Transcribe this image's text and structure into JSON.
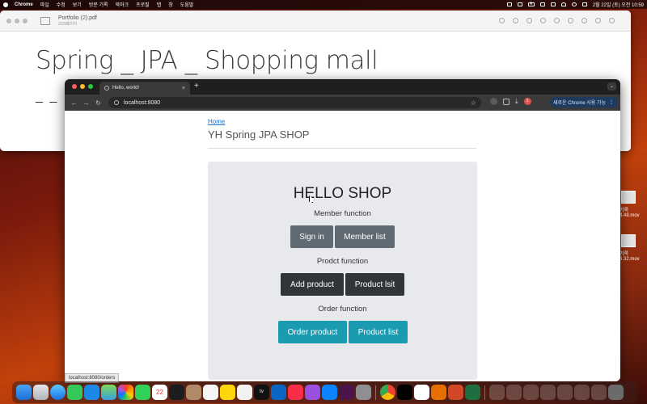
{
  "menubar": {
    "app_name": "Chrome",
    "items": [
      "파일",
      "수정",
      "보기",
      "방문 기록",
      "북마크",
      "프로필",
      "탭",
      "창",
      "도움말"
    ],
    "datetime": "2월 22일 (토) 오전 10:59",
    "input_indicator": "A"
  },
  "pdf_viewer": {
    "filename": "Portfolio (2).pdf",
    "page_info": "2/29페이지",
    "heading": "Spring _ JPA _ Shopping mall",
    "underline_text": "_ _"
  },
  "desktop_files": [
    {
      "line1": "기록",
      "line2": "4.48.mov"
    },
    {
      "line1": "기록",
      "line2": "6.32.mov"
    }
  ],
  "browser": {
    "tab_title": "Hello, world!",
    "tab_close": "×",
    "new_tab": "+",
    "url": "localhost:8080",
    "profile_badge": "1",
    "update_label": "새로운 Chrome 사용 가능",
    "status_url": "localhost:8080/orders"
  },
  "page": {
    "breadcrumb": "Home",
    "site_title": "YH Spring JPA SHOP",
    "hero_title": "HELLO SHOP",
    "member_section": "Member function",
    "product_section": "Prodct function",
    "order_section": "Order function",
    "buttons": {
      "sign_in": "Sign in",
      "member_list": "Member list",
      "add_product": "Add product",
      "product_list_1": "Product lsit",
      "order_product": "Order product",
      "product_list_2": "Product list"
    }
  },
  "colors": {
    "btn_secondary": "#5f6a72",
    "btn_dark": "#303539",
    "btn_info": "#1a9bb0",
    "link": "#1a6fd1"
  },
  "dock_icons": [
    "finder",
    "launchpad",
    "safari",
    "messages",
    "mail",
    "maps",
    "photos",
    "facetime",
    "calendar",
    "terminal",
    "contacts",
    "reminders",
    "notes",
    "freeform",
    "appletv",
    "vscode",
    "music",
    "podcasts",
    "appstore",
    "slack",
    "settings",
    "chrome",
    "intellij",
    "github",
    "java",
    "powerpoint",
    "excel"
  ]
}
